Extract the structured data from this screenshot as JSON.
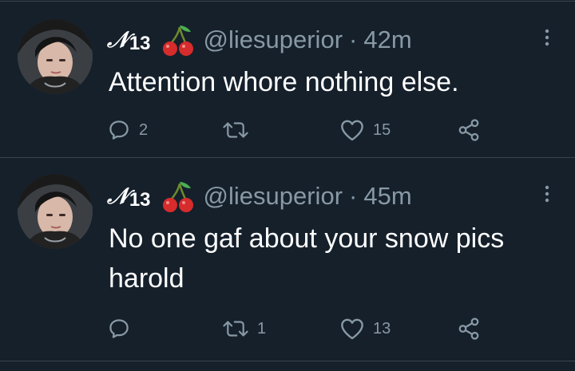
{
  "colors": {
    "background": "#15202b",
    "divider": "#38444d",
    "text_primary": "#ffffff",
    "text_secondary": "#8899a6"
  },
  "tweets": [
    {
      "avatar": "user-avatar-photo",
      "display_name": "𝒩",
      "display_name_suffix": "13",
      "emoji": "cherries-emoji",
      "handle": "@liesuperior",
      "separator": "·",
      "time": "42m",
      "text": "Attention whore nothing else.",
      "replies": "2",
      "retweets": "",
      "likes": "15"
    },
    {
      "avatar": "user-avatar-photo",
      "display_name": "𝒩",
      "display_name_suffix": "13",
      "emoji": "cherries-emoji",
      "handle": "@liesuperior",
      "separator": "·",
      "time": "45m",
      "text": "No one gaf about your snow pics harold",
      "replies": "",
      "retweets": "1",
      "likes": "13"
    }
  ]
}
